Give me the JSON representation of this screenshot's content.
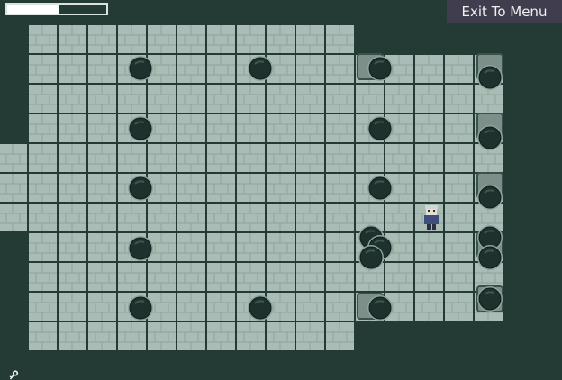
{
  "hud": {
    "exit_label": "Exit To Menu",
    "health_fraction": 0.52
  },
  "colors": {
    "background": "#243a35",
    "floor_tile": "#a9bcb5",
    "floor_grout": "#2d4540",
    "orb": "#1e312d",
    "hud_button": "#3f3d4e"
  },
  "icons": [
    "key-icon",
    "player-sprite",
    "dark-orb-icon",
    "wall-pillar-icon"
  ]
}
